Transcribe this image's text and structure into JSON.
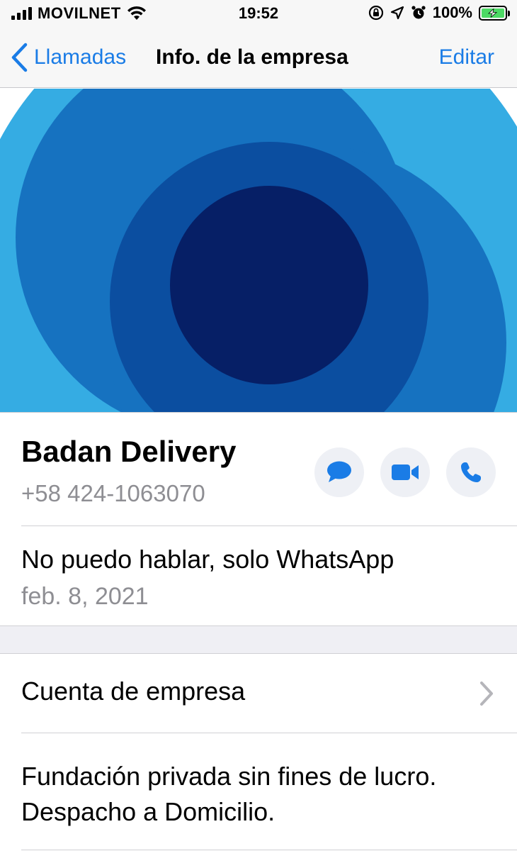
{
  "status_bar": {
    "carrier": "MOVILNET",
    "time": "19:52",
    "battery_percent": "100%",
    "battery_level": 1.0,
    "icons": [
      "signal-icon",
      "wifi-icon",
      "orientation-lock-icon",
      "location-icon",
      "alarm-icon",
      "battery-charging-icon"
    ]
  },
  "nav": {
    "back_label": "Llamadas",
    "title": "Info. de la empresa",
    "edit_label": "Editar"
  },
  "hero": {
    "colors": [
      "#35ace3",
      "#1672c0",
      "#0b4ea0",
      "#061f66"
    ]
  },
  "contact": {
    "name": "Badan Delivery",
    "phone": "+58 424-1063070",
    "actions": [
      "message-icon",
      "video-call-icon",
      "phone-icon"
    ],
    "action_color": "#1a7ce6"
  },
  "about": {
    "text": "No puedo hablar, solo WhatsApp",
    "date": "feb. 8, 2021"
  },
  "business": {
    "label": "Cuenta de empresa"
  },
  "description": {
    "text": "Fundación privada sin fines de lucro. Despacho a Domicilio."
  }
}
